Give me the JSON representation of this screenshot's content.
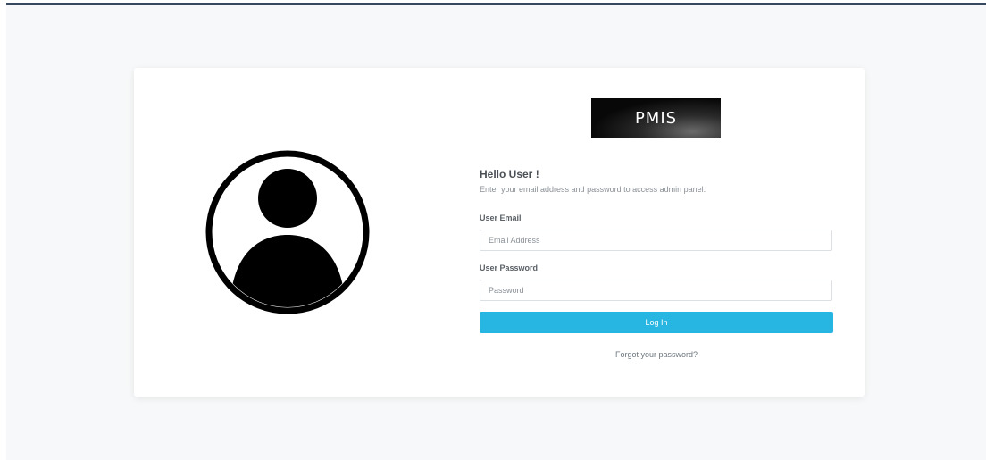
{
  "logo": {
    "text": "PMIS"
  },
  "login": {
    "greeting": "Hello User !",
    "subtitle": "Enter your email address and password to access admin panel.",
    "email_label": "User Email",
    "email_placeholder": "Email Address",
    "email_value": "",
    "password_label": "User Password",
    "password_placeholder": "Password",
    "password_value": "",
    "login_button": "Log In",
    "forgot_link": "Forgot your password?"
  },
  "icons": {
    "avatar": "user-circle-icon"
  },
  "colors": {
    "header_bar": "#38495f",
    "page_background": "#f7f8f9",
    "primary_button": "#27b6e2",
    "text_dark": "#4a4f55",
    "text_muted": "#8a9096"
  }
}
